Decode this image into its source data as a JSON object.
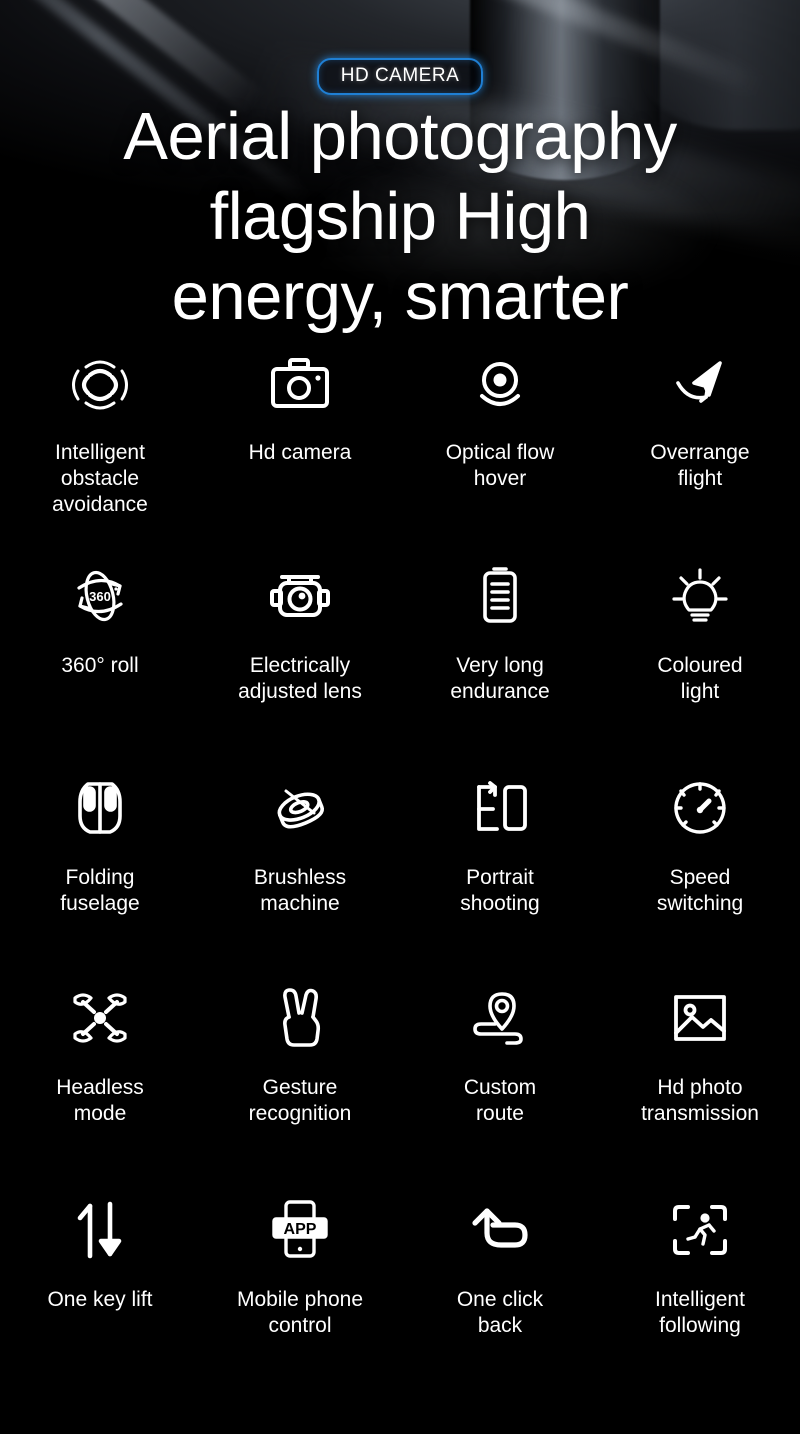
{
  "badge": {
    "text": "HD CAMERA",
    "accent_color": "#1f7fd4"
  },
  "headline": {
    "line1": "Aerial photography",
    "line2": "flagship High",
    "line3": "energy, smarter",
    "color": "#ffffff"
  },
  "background": {
    "color": "#000000"
  },
  "features": {
    "rows": [
      [
        {
          "icon": "obstacle-avoidance-icon",
          "label": "Intelligent\nobstacle\navoidance"
        },
        {
          "icon": "camera-icon",
          "label": "Hd camera"
        },
        {
          "icon": "optical-flow-hover-icon",
          "label": "Optical flow\nhover"
        },
        {
          "icon": "overrange-flight-icon",
          "label": "Overrange\nflight"
        }
      ],
      [
        {
          "icon": "360-roll-icon",
          "label": "360°  roll"
        },
        {
          "icon": "gimbal-camera-icon",
          "label": "Electrically\nadjusted lens"
        },
        {
          "icon": "battery-icon",
          "label": "Very long\nendurance"
        },
        {
          "icon": "lightbulb-icon",
          "label": "Coloured\nlight"
        }
      ],
      [
        {
          "icon": "folding-fuselage-icon",
          "label": "Folding\nfuselage"
        },
        {
          "icon": "brushless-motor-icon",
          "label": "Brushless\nmachine"
        },
        {
          "icon": "portrait-rotate-icon",
          "label": "Portrait\nshooting"
        },
        {
          "icon": "speedometer-icon",
          "label": "Speed\nswitching"
        }
      ],
      [
        {
          "icon": "quadcopter-icon",
          "label": "Headless\nmode"
        },
        {
          "icon": "hand-gesture-icon",
          "label": "Gesture\nrecognition"
        },
        {
          "icon": "map-pin-route-icon",
          "label": "Custom\nroute"
        },
        {
          "icon": "photo-image-icon",
          "label": "Hd photo\ntransmission"
        }
      ],
      [
        {
          "icon": "up-down-arrows-icon",
          "label": "One key lift"
        },
        {
          "icon": "phone-app-icon",
          "label": "Mobile phone\ncontrol",
          "icon_text": "APP"
        },
        {
          "icon": "return-arrow-icon",
          "label": "One click\nback"
        },
        {
          "icon": "follow-tracking-icon",
          "label": "Intelligent\nfollowing"
        }
      ]
    ]
  }
}
